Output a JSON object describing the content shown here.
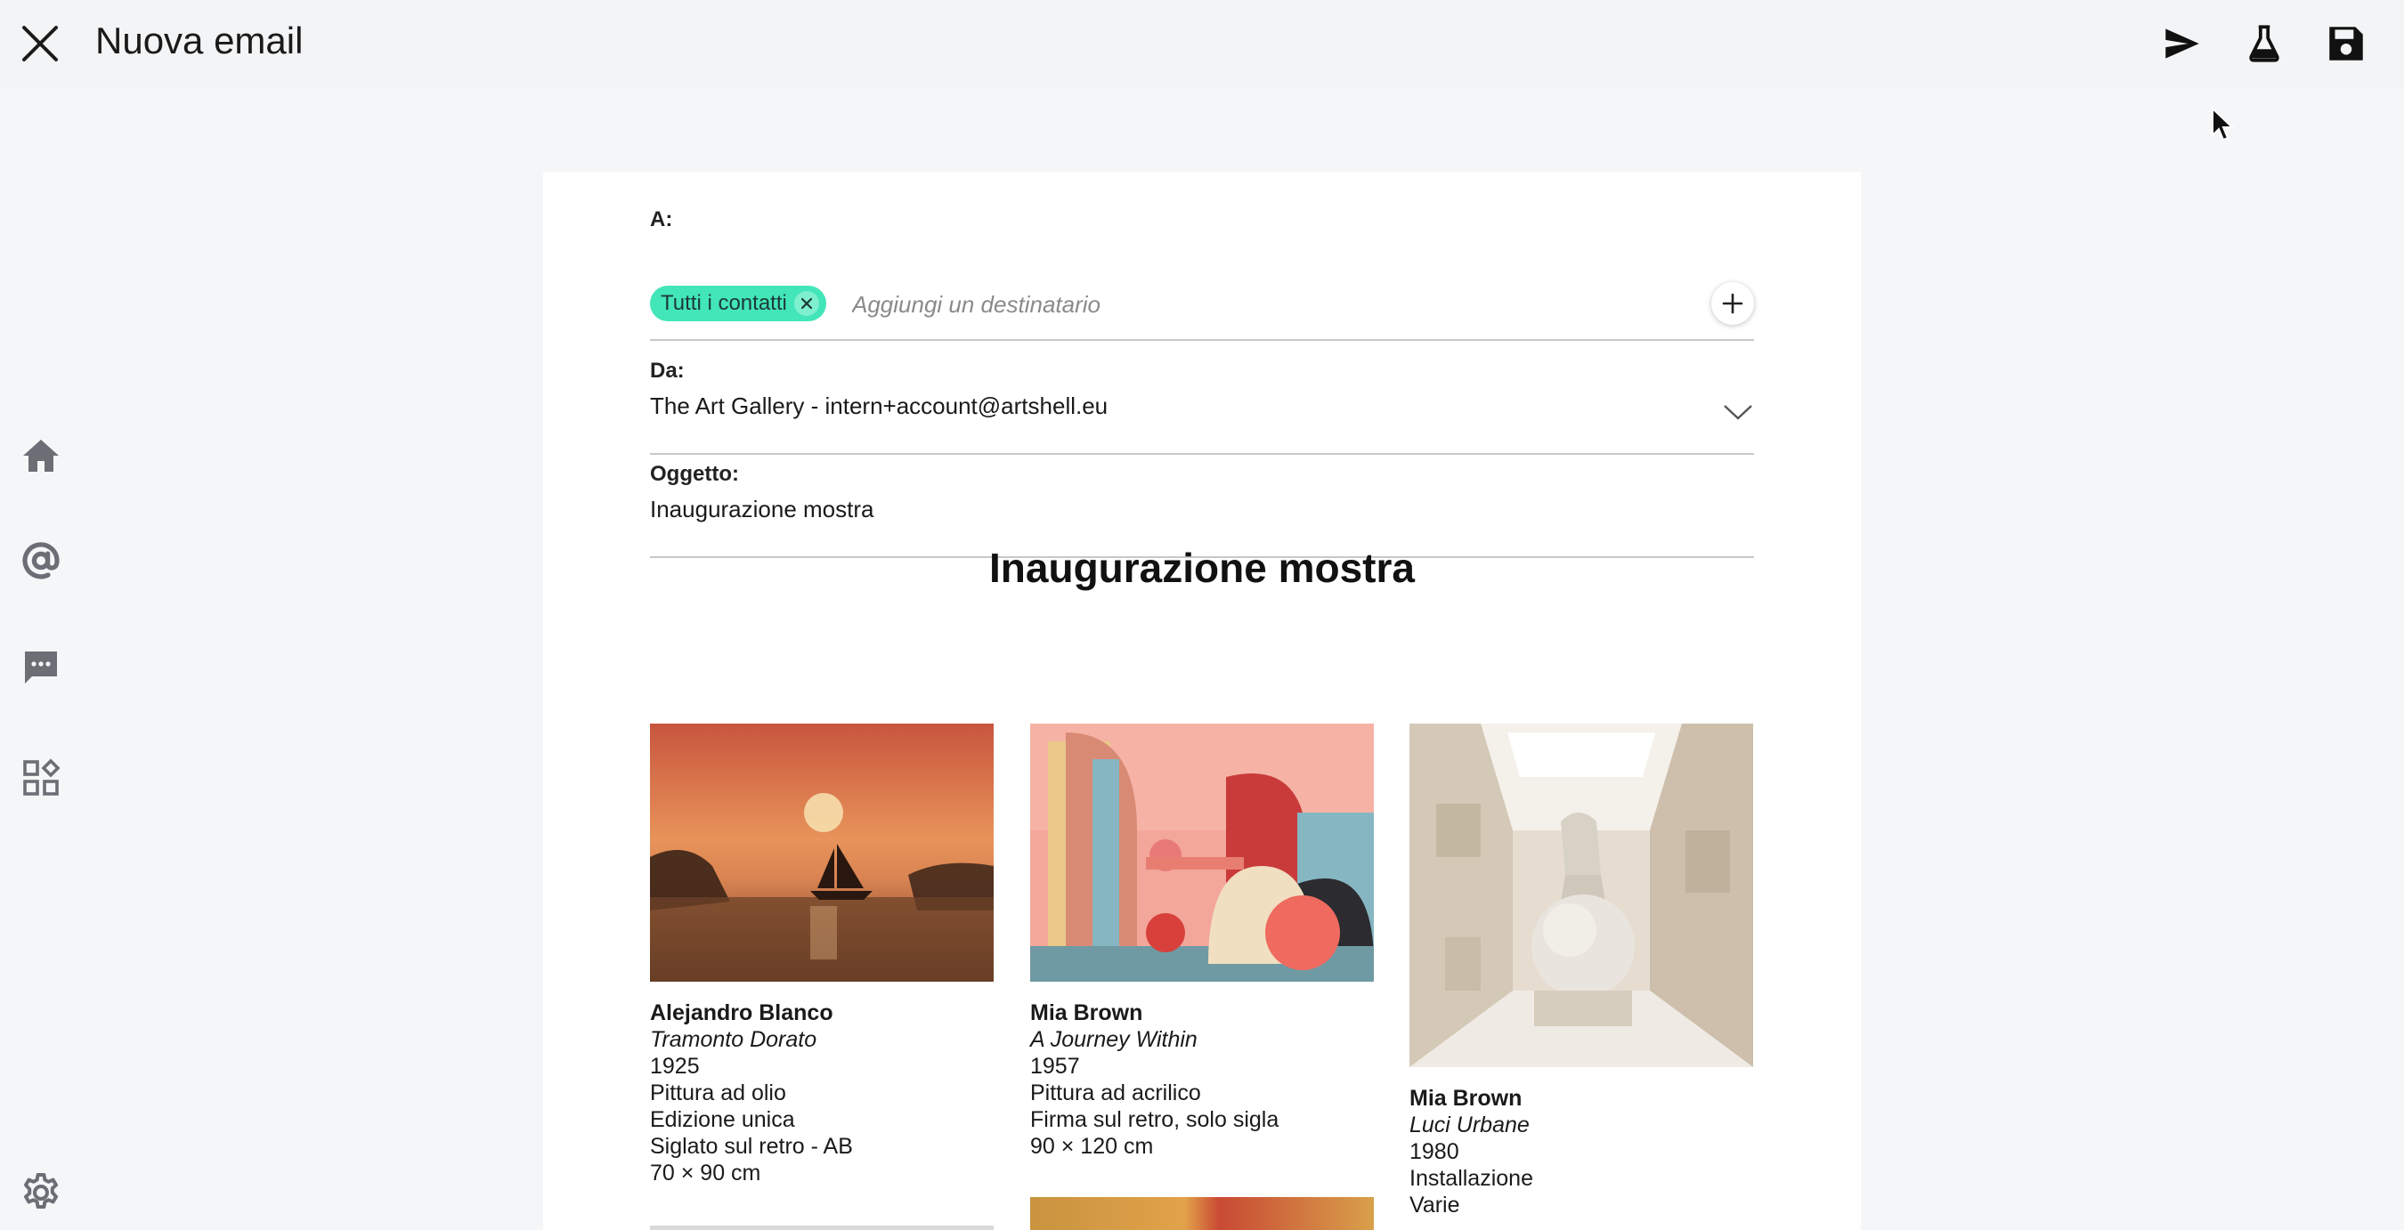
{
  "window": {
    "title": "Nuova email"
  },
  "toolbar": {
    "send": "send-icon",
    "test": "flask-icon",
    "save": "save-icon"
  },
  "sidebar": {
    "items": [
      "home-icon",
      "at-icon",
      "chat-icon",
      "widgets-icon",
      "settings-icon"
    ]
  },
  "email": {
    "to_label": "A:",
    "chip_label": "Tutti i contatti",
    "recipient_placeholder": "Aggiungi un destinatario",
    "from_label": "Da:",
    "from_value": "The Art Gallery - intern+account@artshell.eu",
    "subject_label": "Oggetto:",
    "subject_value": "Inaugurazione mostra",
    "heading": "Inaugurazione mostra"
  },
  "artworks": [
    {
      "artist": "Alejandro Blanco",
      "title": "Tramonto Dorato",
      "year": "1925",
      "medium": "Pittura ad olio",
      "edition": "Edizione unica",
      "signature": "Siglato sul retro - AB",
      "size": "70 × 90 cm"
    },
    {
      "artist": "Mia Brown",
      "title": "A Journey Within",
      "year": "1957",
      "medium": "Pittura ad acrilico",
      "signature": "Firma sul retro, solo sigla",
      "size": "90 × 120 cm"
    },
    {
      "artist": "Mia Brown",
      "title": "Luci Urbane",
      "year": "1980",
      "medium": "Installazione",
      "size": "Varie"
    }
  ],
  "colors": {
    "accent_chip": "#42e6b8",
    "background": "#f5f6f8",
    "card": "#ffffff"
  }
}
